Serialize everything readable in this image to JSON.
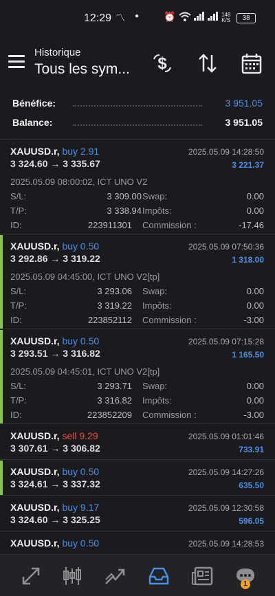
{
  "status_bar": {
    "time": "12:29",
    "network_speed": "148\nK/S",
    "battery": "38"
  },
  "header": {
    "subtitle": "Historique",
    "title": "Tous les sym..."
  },
  "summary": {
    "profit_label": "Bénéfice:",
    "profit_value": "3 951.05",
    "balance_label": "Balance:",
    "balance_value": "3 951.05"
  },
  "colors": {
    "accent_blue": "#4a8fe6",
    "sell_red": "#e84a3d",
    "tp_green": "#8bc34a"
  },
  "labels": {
    "sl": "S/L:",
    "tp": "T/P:",
    "id": "ID:",
    "swap": "Swap:",
    "taxes": "Impôts:",
    "commission": "Commission :"
  },
  "trades": [
    {
      "symbol": "XAUUSD.r,",
      "side": "buy 2.91",
      "prices": "3 324.60 → 3 335.67",
      "close_time": "2025.05.09 14:28:50",
      "profit": "3 221.37",
      "open_info": "2025.05.09 08:00:02, ICT UNO V2",
      "sl": "3 309.00",
      "tp": "3 338.94",
      "id": "223911301",
      "swap": "0.00",
      "taxes": "0.00",
      "commission": "-17.46"
    },
    {
      "symbol": "XAUUSD.r,",
      "side": "buy 0.50",
      "prices": "3 292.86 → 3 319.22",
      "close_time": "2025.05.09 07:50:36",
      "profit": "1 318.00",
      "open_info": "2025.05.09 04:45:00, ICT UNO V2[tp]",
      "sl": "3 293.06",
      "tp": "3 319.22",
      "id": "223852112",
      "swap": "0.00",
      "taxes": "0.00",
      "commission": "-3.00"
    },
    {
      "symbol": "XAUUSD.r,",
      "side": "buy 0.50",
      "prices": "3 293.51 → 3 316.82",
      "close_time": "2025.05.09 07:15:28",
      "profit": "1 165.50",
      "open_info": "2025.05.09 04:45:01, ICT UNO V2[tp]",
      "sl": "3 293.71",
      "tp": "3 316.82",
      "id": "223852209",
      "swap": "0.00",
      "taxes": "0.00",
      "commission": "-3.00"
    },
    {
      "symbol": "XAUUSD.r,",
      "side": "sell 9.29",
      "prices": "3 307.61 → 3 306.82",
      "close_time": "2025.05.09 01:01:46",
      "profit": "733.91"
    },
    {
      "symbol": "XAUUSD.r,",
      "side": "buy 0.50",
      "prices": "3 324.61 → 3 337.32",
      "close_time": "2025.05.09 14:27:26",
      "profit": "635.50"
    },
    {
      "symbol": "XAUUSD.r,",
      "side": "buy 9.17",
      "prices": "3 324.60 → 3 325.25",
      "close_time": "2025.05.09 12:30:58",
      "profit": "596.05"
    },
    {
      "symbol": "XAUUSD.r,",
      "side": "buy 0.50",
      "prices": "",
      "close_time": "2025.05.09 14:28:53",
      "profit": ""
    }
  ],
  "nav": {
    "badge": "1"
  }
}
